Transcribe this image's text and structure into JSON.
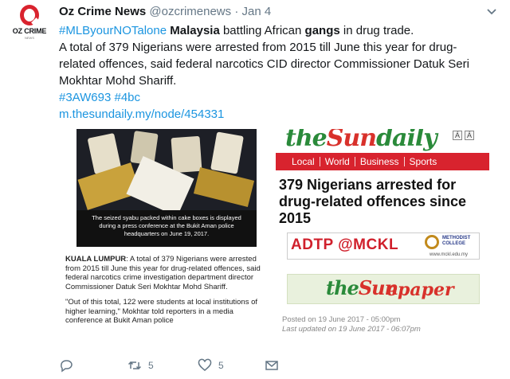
{
  "author": {
    "name": "Oz Crime News",
    "handle": "@ozcrimenews",
    "separator": "·",
    "date": "Jan 4",
    "avatar_text": "OZ CRIME",
    "avatar_sub": "NEWS"
  },
  "tweet": {
    "hashtag_main": "#MLByourNOTalone",
    "word_malaysia": "Malaysia",
    "text_battling": "battling African",
    "word_gangs": "gangs",
    "text_drug_trade": "in drug trade.",
    "body_line1": "A total of 379 Nigerians were arrested from 2015 till June this year for drug-",
    "body_line2": "related offences, said federal narcotics CID director Commissioner Datuk Seri",
    "body_line3": "Mokhtar Mohd Shariff.",
    "tags": "#3AW693 #4bc",
    "url": "m.thesundaily.my/node/454331"
  },
  "card": {
    "photo_caption": "The seized syabu packed within cake boxes is displayed during a press conference at the Bukit Aman police headquarters on June 19, 2017.",
    "dateline": "KUALA LUMPUR",
    "para1": ": A total of 379 Nigerians were arrested from 2015 till June this year for drug-related offences, said federal narcotics crime investigation department director Commissioner Datuk Seri Mokhtar Mohd Shariff.",
    "para2": "\"Out of this total, 122 were students at local institutions of higher learning,\" Mokhtar told reporters in a media conference at Bukit Aman police",
    "logo_the": "the",
    "logo_sun": "Sun",
    "logo_daily": "daily",
    "font_small": "Á",
    "font_large": "Á",
    "nav": [
      "Local",
      "World",
      "Business",
      "Sports"
    ],
    "headline": "379 Nigerians arrested for drug-related offences since 2015",
    "ad1_text": "ADTP @MCKL",
    "ad1_brand_1": "METHODIST",
    "ad1_brand_2": "COLLEGE",
    "ad1_url": "www.mckl.edu.my",
    "ad2_the": "the",
    "ad2_sun": "Sun",
    "ad2_epaper": "epaper",
    "posted": "Posted on 19 June 2017 - 05:00pm",
    "updated": "Last updated on 19 June 2017 - 06:07pm"
  },
  "actions": {
    "reply_icon": "reply-icon",
    "retweet_icon": "retweet-icon",
    "retweet_count": "5",
    "like_icon": "heart-icon",
    "like_count": "5",
    "message_icon": "envelope-icon"
  },
  "colors": {
    "link": "#1b95e0",
    "brand_red": "#d8232e",
    "sun_green": "#2a8a3a",
    "muted": "#657786"
  }
}
